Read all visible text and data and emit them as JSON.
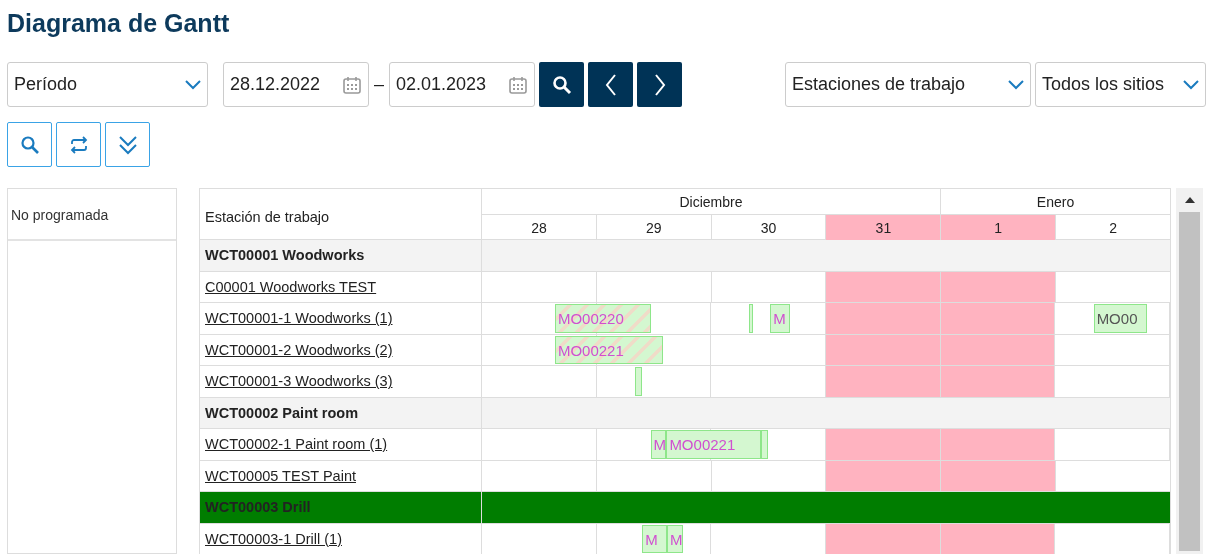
{
  "title": "Diagrama de Gantt",
  "toolbar": {
    "period": {
      "value": "Período"
    },
    "date_from": {
      "value": "28.12.2022"
    },
    "separator": "–",
    "date_to": {
      "value": "02.01.2023"
    },
    "view": {
      "value": "Estaciones de trabajo"
    },
    "sites": {
      "value": "Todos los sitios"
    }
  },
  "unscheduled": {
    "title": "No programada"
  },
  "gantt": {
    "column_title": "Estación de trabajo",
    "months": [
      {
        "label": "Diciembre",
        "days": [
          {
            "label": "28",
            "holiday": false
          },
          {
            "label": "29",
            "holiday": false
          },
          {
            "label": "30",
            "holiday": false
          },
          {
            "label": "31",
            "holiday": true
          }
        ]
      },
      {
        "label": "Enero",
        "days": [
          {
            "label": "1",
            "holiday": true
          },
          {
            "label": "2",
            "holiday": false
          }
        ]
      }
    ],
    "rows": [
      {
        "kind": "group",
        "label": "WCT00001 Woodworks",
        "selected": false
      },
      {
        "kind": "station",
        "label": "C00001 Woodworks TEST"
      },
      {
        "kind": "station",
        "label": "WCT00001-1 Woodworks (1)",
        "bars": [
          {
            "label": "MO00220",
            "kind": "delayed"
          },
          {
            "kind": "planned"
          },
          {
            "label": "M",
            "kind": "planned"
          },
          {
            "label": "MO00",
            "kind": "released"
          }
        ]
      },
      {
        "kind": "station",
        "label": "WCT00001-2 Woodworks (2)",
        "bars": [
          {
            "label": "MO00221",
            "kind": "delayed"
          }
        ]
      },
      {
        "kind": "station",
        "label": "WCT00001-3 Woodworks (3)",
        "bars": [
          {
            "kind": "planned"
          }
        ]
      },
      {
        "kind": "group",
        "label": "WCT00002 Paint room",
        "selected": false
      },
      {
        "kind": "station",
        "label": "WCT00002-1 Paint room (1)",
        "bars": [
          {
            "label": "M",
            "kind": "planned"
          },
          {
            "label": "MO00221",
            "kind": "planned"
          },
          {
            "kind": "planned"
          }
        ]
      },
      {
        "kind": "station",
        "label": "WCT00005 TEST Paint"
      },
      {
        "kind": "group",
        "label": "WCT00003 Drill",
        "selected": true
      },
      {
        "kind": "station",
        "label": "WCT00003-1 Drill (1)",
        "bars": [
          {
            "label": "M",
            "kind": "planned"
          },
          {
            "label": "M",
            "kind": "planned"
          }
        ]
      }
    ]
  }
}
